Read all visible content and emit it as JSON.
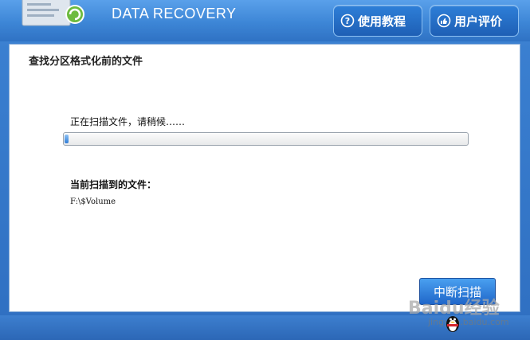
{
  "header": {
    "app_title": "DATA RECOVERY",
    "help_label": "使用教程",
    "rate_label": "用户评价"
  },
  "panel": {
    "title": "查找分区格式化前的文件",
    "status_text": "正在扫描文件，请稍候……",
    "progress_fraction": 0.01,
    "current_file_label": "当前扫描到的文件：",
    "current_file": "F:\\$Volume",
    "stop_button_label": "中断扫描"
  },
  "watermark": {
    "big_text": "Baidu经验",
    "url_text": "jingyan.baidu.com"
  },
  "colors": {
    "header_blue": "#3d86d6",
    "button_blue": "#1e5fb5",
    "progress_blue": "#2f7bd6"
  }
}
